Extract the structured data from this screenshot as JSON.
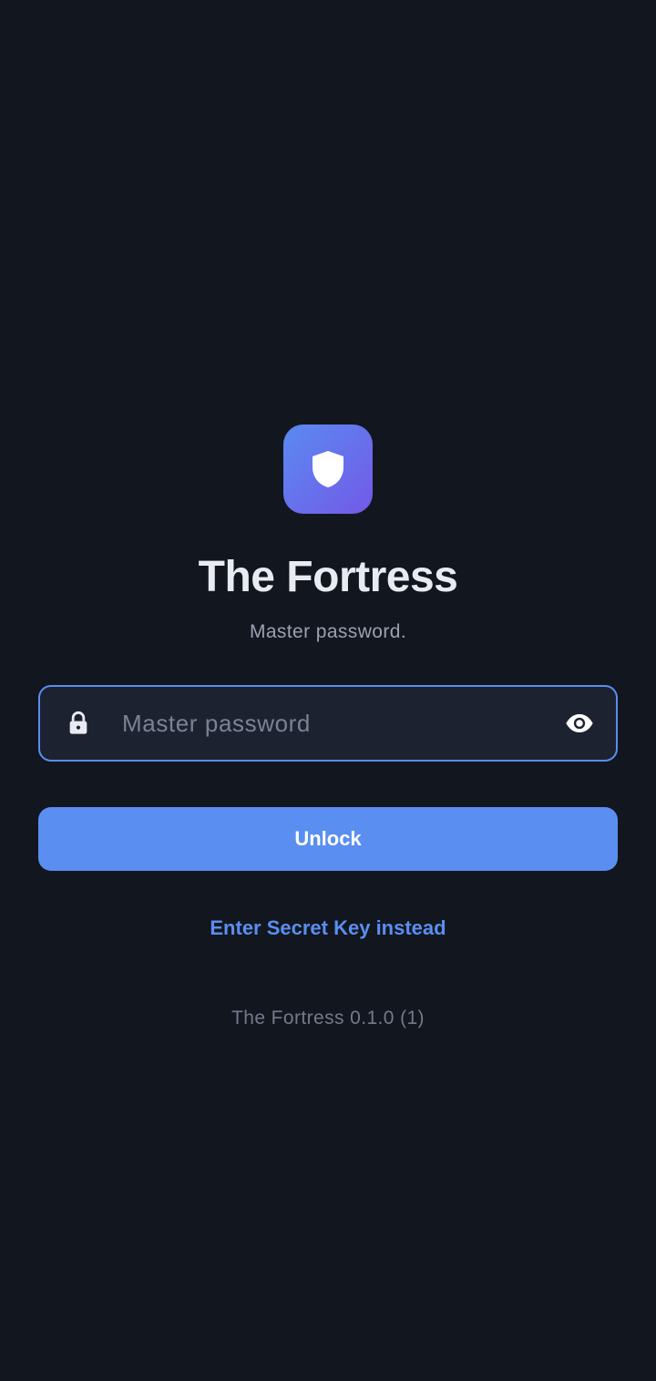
{
  "app": {
    "title": "The Fortress",
    "subtitle": "Master password.",
    "logo_icon": "shield-icon"
  },
  "password_field": {
    "placeholder": "Master password",
    "value": "",
    "leading_icon": "lock-icon",
    "trailing_icon": "eye-icon"
  },
  "actions": {
    "unlock_label": "Unlock",
    "secret_key_label": "Enter Secret Key instead"
  },
  "footer": {
    "version": "The Fortress 0.1.0 (1)"
  },
  "colors": {
    "background": "#12161e",
    "accent": "#5a8ef0",
    "logo_gradient_start": "#5a8af0",
    "logo_gradient_end": "#7359e8",
    "field_background": "#1d2230"
  }
}
